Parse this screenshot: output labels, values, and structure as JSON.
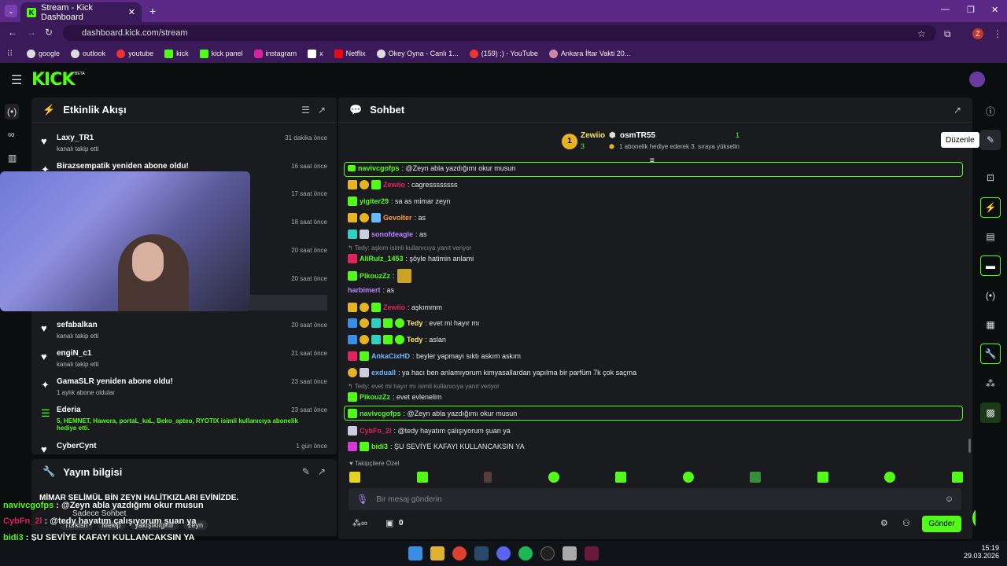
{
  "browser": {
    "tab_title": "Stream - Kick Dashboard",
    "url": "dashboard.kick.com/stream",
    "bookmarks": [
      "google",
      "outlook",
      "youtube",
      "kick",
      "kick panel",
      "instagram",
      "x",
      "Netflix",
      "Okey Oyna - Canlı 1...",
      "(159) ;) - YouTube",
      "Ankara İftar Vakti 20..."
    ]
  },
  "kick": {
    "logo": "KICK",
    "beta": "BETA"
  },
  "activity": {
    "title": "Etkinlik Akışı",
    "events": [
      {
        "name": "Laxy_TR1",
        "sub": "kanalı takip etti",
        "time": "31 dakika önce"
      },
      {
        "name": "Birazsempatik yeniden abone oldu!",
        "sub": "",
        "time": "16 saat önce"
      },
      {
        "name": "",
        "sub": "",
        "time": "17 saat önce"
      },
      {
        "name": "",
        "sub": "",
        "time": "18 saat önce"
      },
      {
        "name": "",
        "sub": "",
        "time": "20 saat önce"
      },
      {
        "name": "",
        "sub": "",
        "time": "20 saat önce"
      },
      {
        "name": "sefabalkan",
        "sub": "kanalı takip etti",
        "time": "20 saat önce"
      },
      {
        "name": "engiN_c1",
        "sub": "kanalı takip etti",
        "time": "21 saat önce"
      },
      {
        "name": "GamaSLR yeniden abone oldu!",
        "sub": "1 aylık abone oldular",
        "time": "23 saat önce"
      },
      {
        "name": "Ederia",
        "sub": "5, HEMNET, Hawora, portaL_kaL, Beko_apteo, RYOTIX isimli kullanıcıya abonelik hediye etti.",
        "time": "23 saat önce"
      },
      {
        "name": "CyberCynt",
        "sub": "",
        "time": "1 gün önce"
      }
    ]
  },
  "stream_info": {
    "title": "Yayın bilgisi",
    "stream_title": "MİMAR SELİMÜL BİN ZEYN HALİTKIZLARI EVİNİZDE.",
    "only_chat": "Sadece Sohbet",
    "tags": [
      "Türkish",
      "Mekip",
      "yakışıklıgirlir",
      "zeyn"
    ]
  },
  "chat": {
    "title": "Sohbet",
    "top1_name": "Zewiio",
    "top1_count": "3",
    "top2_name": "osmTR55",
    "top2_count": "1",
    "top2_note": "1 abonelik hediye ederek 3. sıraya yükselin",
    "tooltip": "Düzenle",
    "messages": [
      {
        "user": "navivcgofps",
        "text": ": @Zeyn abla yazdığımı okur musun",
        "color": "#53fc18"
      },
      {
        "user": "Zewiio",
        "text": ": cagressssssss",
        "color": "#e0245e"
      },
      {
        "user": "yigiter29",
        "text": ": sa as mimar zeyn",
        "color": "#53fc18"
      },
      {
        "user": "Gevolter",
        "text": ": as",
        "color": "#ff9a3c"
      },
      {
        "user": "sonofdeagle",
        "text": ": as",
        "color": "#b685ff"
      },
      {
        "reply": "Tedy: aşkım isimli kullanıcıya yanıt veriyor"
      },
      {
        "user": "AliRulz_1453",
        "text": ": şöyle hatimin anlami",
        "color": "#53fc18"
      },
      {
        "user": "PikouzZz",
        "text": ":",
        "color": "#53fc18"
      },
      {
        "user": "harbimert",
        "text": ": as",
        "color": "#b685ff"
      },
      {
        "user": "Zewiio",
        "text": ": aşkımmm",
        "color": "#e0245e"
      },
      {
        "user": "Tedy",
        "text": ": evet mi hayır mı",
        "color": "#f5e663"
      },
      {
        "user": "Tedy",
        "text": ": aslan",
        "color": "#f5e663"
      },
      {
        "user": "AnkaCixHD",
        "text": ": beyler yapmayı sıktı askım askım",
        "color": "#6ab8ff"
      },
      {
        "user": "exduall",
        "text": ": ya hacı ben anlamıyorum kimyasallardan yapılma bir parfüm 7k çok saçma",
        "color": "#6ab8ff"
      },
      {
        "reply": "Tedy: evet mi hayır mı isimli kullanıcıya yanıt veriyor"
      },
      {
        "user": "PikouzZz",
        "text": ": evet evlenelim",
        "color": "#53fc18"
      },
      {
        "user": "navivcgofps",
        "text": ": @Zeyn abla yazdığımı okur musun",
        "color": "#53fc18"
      },
      {
        "user": "CybFn_2l",
        "text": ": @tedy hayatım çalışıyorum şuan ya",
        "color": "#e0245e"
      },
      {
        "user": "bidi3",
        "text": ": ŞU SEVİYE KAFAYI KULLANCAKSIN YA",
        "color": "#53fc18"
      }
    ],
    "followers_only": "Takipçilere Özel",
    "placeholder": "Bir mesaj gönderin",
    "count": "0",
    "send": "Gönder"
  },
  "overlay": [
    {
      "user": "navivcgofps",
      "text": " : @Zeyn abla yazdığımı okur musun",
      "color": "#53fc18"
    },
    {
      "user": "CybFn_2l",
      "text": " : @tedy hayatım çalışıyorum şuan ya",
      "color": "#e0245e"
    },
    {
      "user": "bidi3",
      "text": " : ŞU SEVİYE KAFAYI KULLANCAKSIN YA",
      "color": "#53fc18"
    }
  ],
  "clock": {
    "time": "15:19",
    "date": "29.03.2026"
  }
}
